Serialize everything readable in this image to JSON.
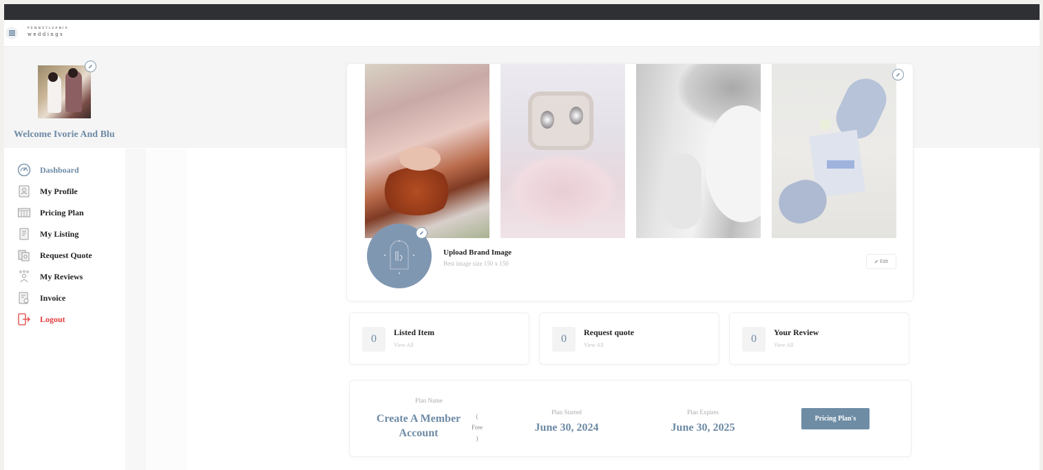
{
  "brand": {
    "line1": "PENNSYLVANIA",
    "line2": "weddings"
  },
  "sidebar": {
    "welcome": "Welcome Ivorie And Blu",
    "items": [
      {
        "label": "Dashboard",
        "icon": "dashboard-gauge-icon",
        "active": true
      },
      {
        "label": "My Profile",
        "icon": "profile-card-icon"
      },
      {
        "label": "Pricing Plan",
        "icon": "pricing-table-icon"
      },
      {
        "label": "My Listing",
        "icon": "listing-document-icon"
      },
      {
        "label": "Request Quote",
        "icon": "request-quote-icon"
      },
      {
        "label": "My Reviews",
        "icon": "reviews-stars-icon"
      },
      {
        "label": "Invoice",
        "icon": "invoice-icon"
      },
      {
        "label": "Logout",
        "icon": "logout-icon"
      }
    ]
  },
  "brand_section": {
    "upload_title": "Upload Brand Image",
    "upload_hint": "Best image size 150 x 150",
    "edit_label": "Edit"
  },
  "stats": [
    {
      "value": "0",
      "title": "Listed Item",
      "link": "View All"
    },
    {
      "value": "0",
      "title": "Request quote",
      "link": "View All"
    },
    {
      "value": "0",
      "title": "Your Review",
      "link": "View All"
    }
  ],
  "plan": {
    "name_label": "Plan Name",
    "name_value_line1": "Create A Member",
    "name_value_line2": "Account",
    "tier_open": "(",
    "tier_label": "Free",
    "tier_close": ")",
    "started_label": "Plan Started",
    "started_value": "June 30, 2024",
    "expires_label": "Plan Expires",
    "expires_value": "June 30, 2025",
    "button_label": "Pricing Plan's"
  },
  "colors": {
    "accent": "#6d8aa5",
    "logout": "#e03c3c",
    "topbar": "#2f3033",
    "button": "#6e8ca4"
  }
}
